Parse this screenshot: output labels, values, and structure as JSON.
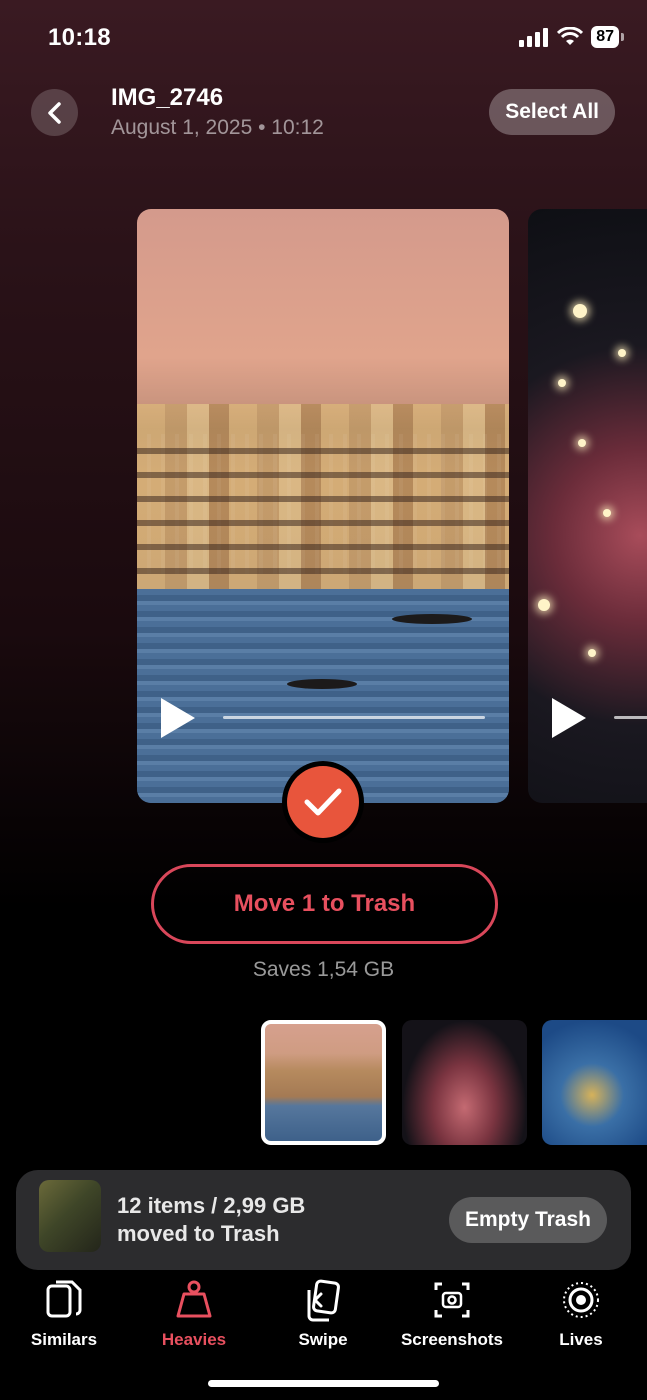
{
  "status_bar": {
    "time": "10:18",
    "battery": "87"
  },
  "header": {
    "title": "IMG_2746",
    "subtitle": "August 1, 2025 • 10:12",
    "select_all": "Select All"
  },
  "actions": {
    "move_label": "Move 1 to Trash",
    "saves_label": "Saves 1,54 GB"
  },
  "trash_banner": {
    "line1": "12 items / 2,99 GB",
    "line2": "moved to Trash",
    "empty_label": "Empty Trash"
  },
  "tabs": [
    {
      "label": "Similars",
      "icon": "documents-icon",
      "active": false
    },
    {
      "label": "Heavies",
      "icon": "weight-icon",
      "active": true
    },
    {
      "label": "Swipe",
      "icon": "swipe-cards-icon",
      "active": false
    },
    {
      "label": "Screenshots",
      "icon": "screenshot-camera-icon",
      "active": false
    },
    {
      "label": "Lives",
      "icon": "live-photo-icon",
      "active": false
    }
  ],
  "colors": {
    "accent": "#e8505f",
    "check": "#e8553c"
  }
}
